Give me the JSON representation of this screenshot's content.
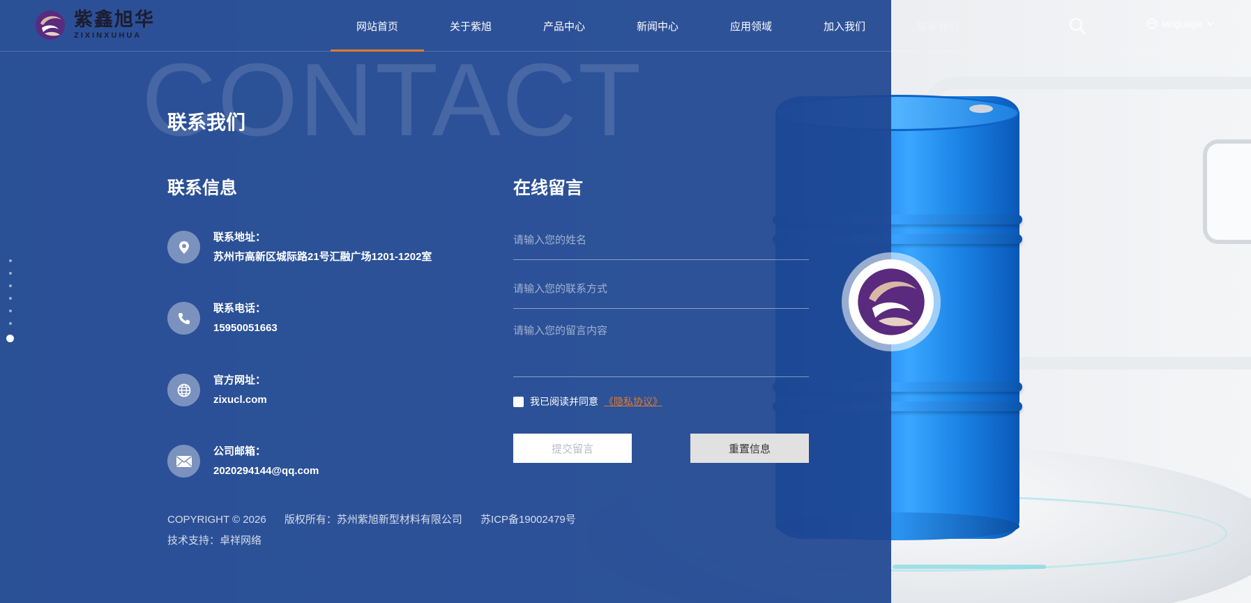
{
  "brand": {
    "name_cn": "紫鑫旭华",
    "name_en": "ZIXINXUHUA"
  },
  "nav": {
    "items": [
      {
        "label": "网站首页",
        "active": true
      },
      {
        "label": "关于紫旭"
      },
      {
        "label": "产品中心"
      },
      {
        "label": "新闻中心"
      },
      {
        "label": "应用领域"
      },
      {
        "label": "加入我们"
      },
      {
        "label": "联系我们"
      }
    ],
    "language_label": "language",
    "search_icon": "search-icon"
  },
  "hero": {
    "watermark": "CONTACT",
    "title": "联系我们"
  },
  "contact_info": {
    "title": "联系信息",
    "items": [
      {
        "icon": "location-pin-icon",
        "label": "联系地址：",
        "value": "苏州市高新区城际路21号汇融广场1201-1202室"
      },
      {
        "icon": "phone-icon",
        "label": "联系电话：",
        "value": "15950051663"
      },
      {
        "icon": "globe-icon",
        "label": "官方网址：",
        "value": "zixucl.com"
      },
      {
        "icon": "mail-icon",
        "label": "公司邮箱：",
        "value": "2020294144@qq.com"
      }
    ]
  },
  "message_form": {
    "title": "在线留言",
    "name_placeholder": "请输入您的姓名",
    "contact_placeholder": "请输入您的联系方式",
    "message_placeholder": "请输入您的留言内容",
    "agree_text": "我已阅读并同意",
    "privacy_link": "《隐私协议》",
    "submit_label": "提交留言",
    "reset_label": "重置信息"
  },
  "footer": {
    "copyright": "COPYRIGHT © 2026",
    "owner": "版权所有：苏州紫旭新型材料有限公司",
    "icp": "苏ICP备19002479号",
    "tech_support": "技术支持：卓祥网络"
  },
  "colors": {
    "overlay_blue": "#1e4691",
    "accent_orange": "#e07a2f",
    "brand_purple": "#5a2a7e"
  },
  "pager": {
    "count": 7,
    "active_index": 6
  }
}
